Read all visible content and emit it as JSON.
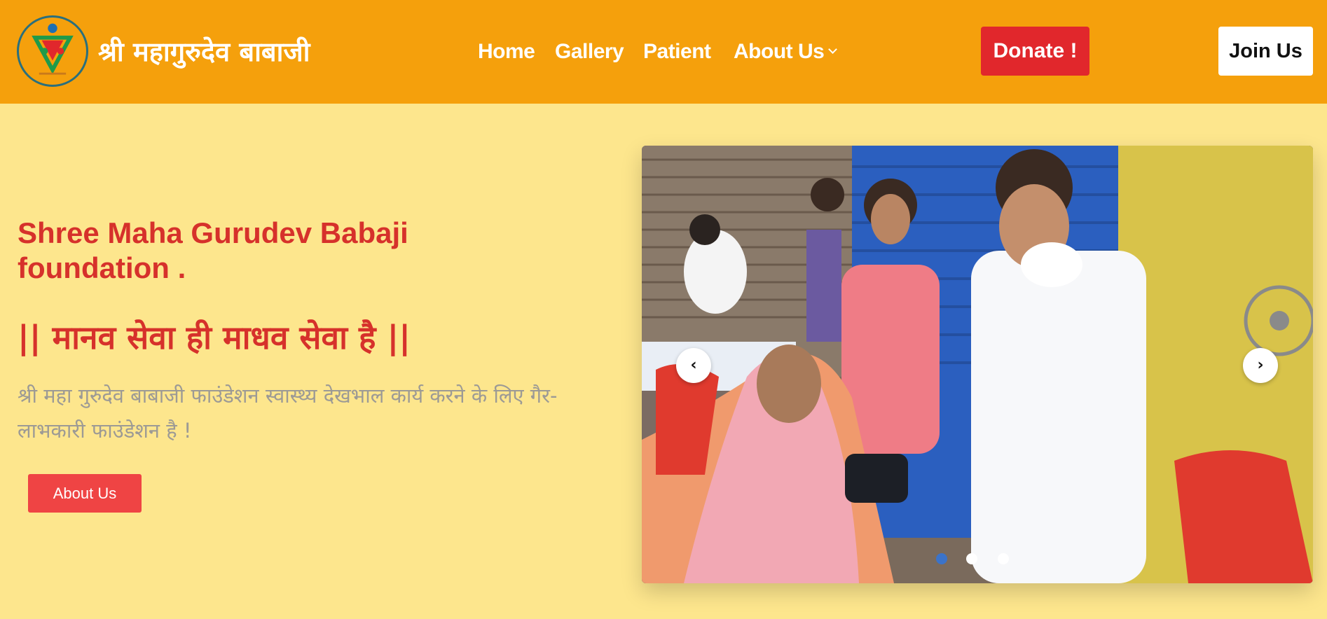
{
  "header": {
    "brand": "श्री महागुरुदेव बाबाजी",
    "nav": [
      {
        "label": "Home"
      },
      {
        "label": "Gallery"
      },
      {
        "label": "Patient"
      },
      {
        "label": "About Us",
        "has_dropdown": true
      }
    ],
    "donate_label": "Donate !",
    "join_label": "Join Us"
  },
  "hero": {
    "title": "Shree Maha Gurudev Babaji foundation .",
    "motto": "|| मानव सेवा ही माधव सेवा है ||",
    "description": "श्री महा गुरुदेव बाबाजी फाउंडेशन स्वास्थ्य देखभाल कार्य करने के लिए गैर-लाभकारी फाउंडेशन है !",
    "about_button": "About Us"
  },
  "carousel": {
    "prev_icon": "chevron-left",
    "next_icon": "chevron-right",
    "slides": 3,
    "active_slide": 1
  },
  "colors": {
    "header_bg": "#f5a00c",
    "page_bg": "#fde68d",
    "accent_red": "#d6312b",
    "donate_bg": "#e1272c",
    "about_btn_bg": "#ef4444",
    "active_dot": "#3b73c9"
  }
}
